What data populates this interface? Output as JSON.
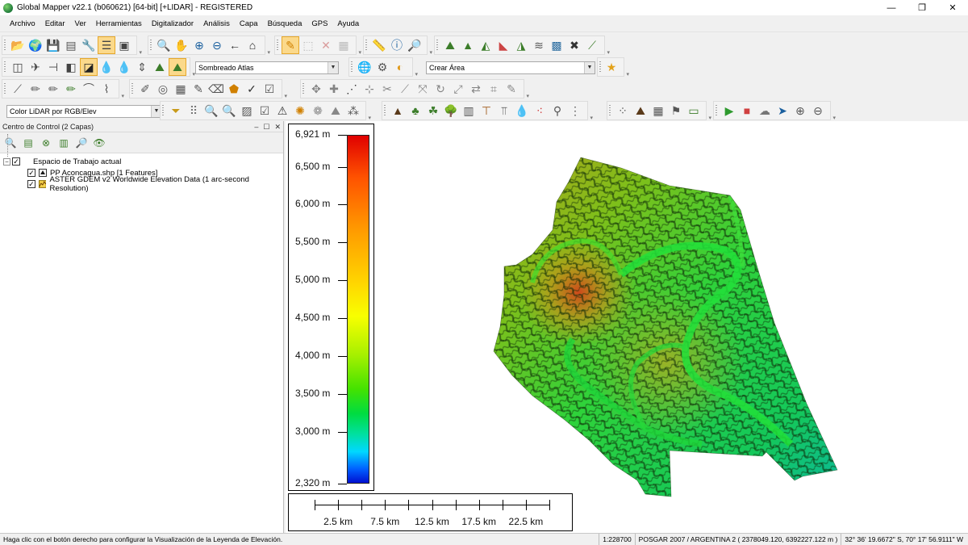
{
  "window": {
    "title": "Global Mapper  v22.1 (b060621) [64-bit] [+LIDAR] - REGISTERED",
    "controls": {
      "minimize": "—",
      "maximize": "❐",
      "close": "✕"
    }
  },
  "menu": [
    "Archivo",
    "Editar",
    "Ver",
    "Herramientas",
    "Digitalizador",
    "Análisis",
    "Capa",
    "Búsqueda",
    "GPS",
    "Ayuda"
  ],
  "toolbar": {
    "shader_combo": "Sombreado Atlas",
    "area_combo": "Crear Área",
    "lidar_color_combo": "Color LiDAR por RGB/Elev"
  },
  "control_center": {
    "title": "Centro de Control (2 Capas)",
    "title_controls": {
      "pin": "–",
      "float": "☐",
      "close": "✕"
    },
    "workspace_label": "Espacio de Trabajo actual",
    "layers": [
      {
        "name": "PP Aconcagua.shp [1 Features]",
        "checked": "✓"
      },
      {
        "name": "ASTER GDEM v2 Worldwide Elevation Data (1 arc-second Resolution)",
        "checked": "✓"
      }
    ],
    "workspace_checked": "✓",
    "expander": "−"
  },
  "legend": {
    "labels": [
      "6,921 m",
      "6,500 m",
      "6,000 m",
      "5,500 m",
      "5,000 m",
      "4,500 m",
      "4,000 m",
      "3,500 m",
      "3,000 m",
      "2,320 m"
    ],
    "values_m": [
      6921,
      6500,
      6000,
      5500,
      5000,
      4500,
      4000,
      3500,
      3000,
      2320
    ],
    "min_m": 2320,
    "max_m": 6921
  },
  "scale": {
    "labels": [
      "2.5 km",
      "7.5 km",
      "12.5 km",
      "17.5 km",
      "22.5 km"
    ]
  },
  "status": {
    "hint": "Haga clic con el botón derecho para configurar la Visualización de la Leyenda de Elevación.",
    "scale": "1:228700",
    "projection": "POSGAR 2007 / ARGENTINA 2 ( 2378049.120, 6392227.122 m )",
    "coords": "32° 36' 19.6672\" S, 70° 17' 56.9111\" W"
  }
}
